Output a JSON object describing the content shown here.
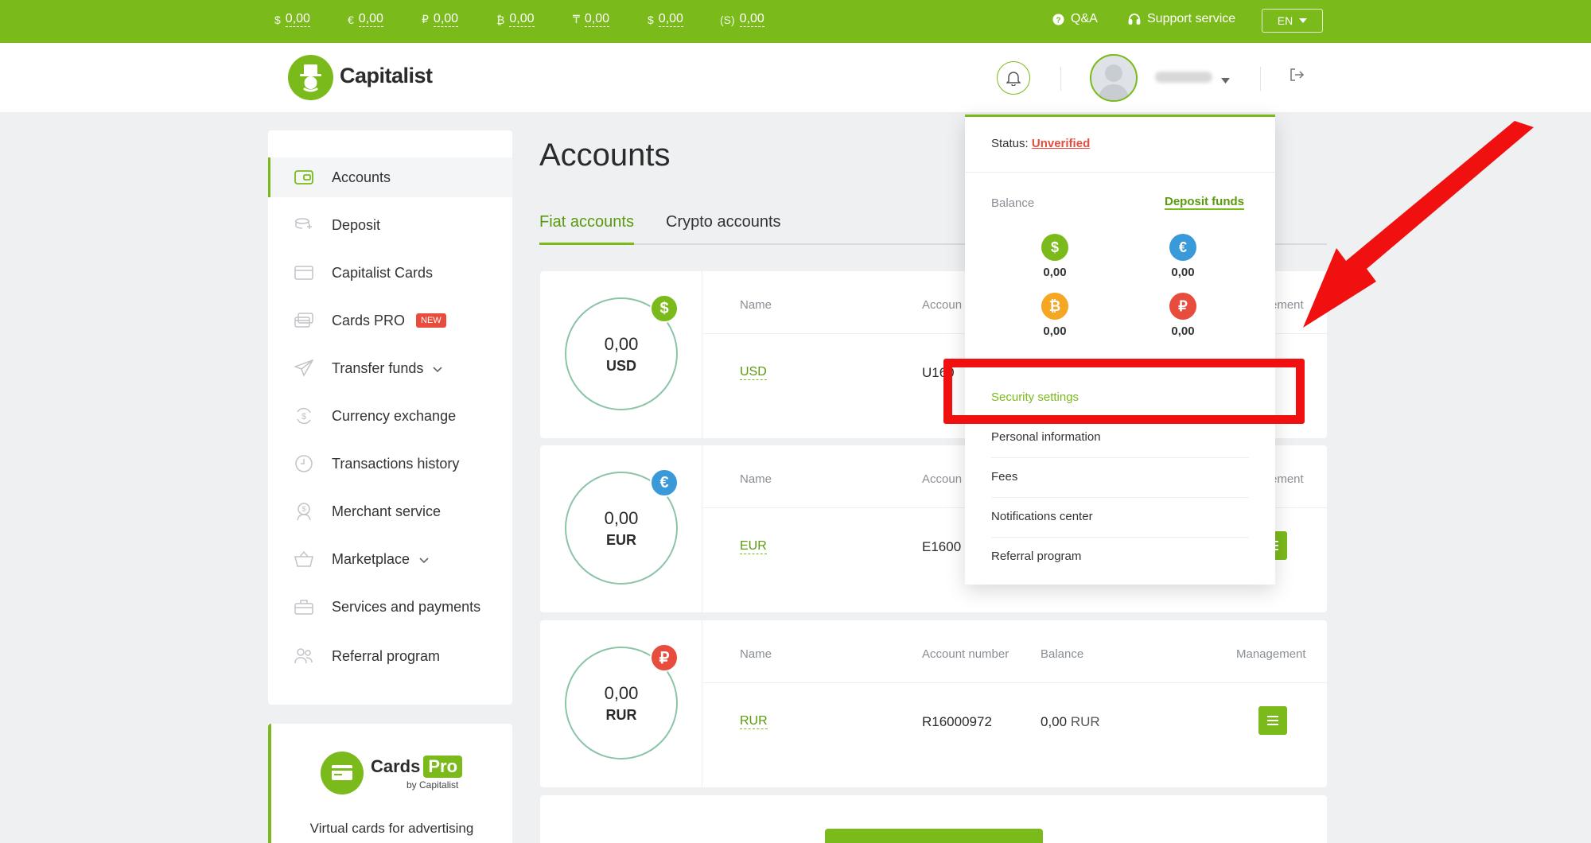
{
  "topbar": {
    "balances": [
      {
        "symbol": "$",
        "amount": "0,00"
      },
      {
        "symbol": "€",
        "amount": "0,00"
      },
      {
        "symbol": "₽",
        "amount": "0,00"
      },
      {
        "symbol": "₿",
        "amount": "0,00"
      },
      {
        "symbol": "₸",
        "amount": "0,00"
      },
      {
        "symbol": "$",
        "amount": "0,00"
      },
      {
        "symbol": "(S)",
        "amount": "0,00"
      }
    ],
    "qa_label": "Q&A",
    "support_label": "Support service",
    "language": "EN",
    "color": "#7aba1a"
  },
  "header": {
    "brand": "Capitalist"
  },
  "sidebar": {
    "items": [
      {
        "label": "Accounts",
        "icon": "wallet-icon"
      },
      {
        "label": "Deposit",
        "icon": "deposit-icon"
      },
      {
        "label": "Capitalist Cards",
        "icon": "card-icon"
      },
      {
        "label": "Cards PRO",
        "icon": "cards-pro-icon",
        "badge": "NEW"
      },
      {
        "label": "Transfer funds",
        "icon": "paper-plane-icon"
      },
      {
        "label": "Currency exchange",
        "icon": "exchange-icon"
      },
      {
        "label": "Transactions history",
        "icon": "clock-icon"
      },
      {
        "label": "Merchant service",
        "icon": "merchant-icon"
      },
      {
        "label": "Marketplace",
        "icon": "basket-icon"
      },
      {
        "label": "Services and payments",
        "icon": "services-icon"
      },
      {
        "label": "Referral program",
        "icon": "people-icon"
      }
    ],
    "active": "Accounts"
  },
  "promo": {
    "title": "Cards",
    "title_badge": "Pro",
    "subtitle": "by Capitalist",
    "description": "Virtual cards for advertising"
  },
  "main": {
    "title": "Accounts",
    "tabs": [
      {
        "label": "Fiat accounts",
        "active": true
      },
      {
        "label": "Crypto accounts",
        "active": false
      }
    ],
    "accounts": [
      {
        "currency": "USD",
        "symbol": "$",
        "value": "0,00",
        "badge_color": "#7aba1a",
        "headers": {
          "name": "Name",
          "account": "Accoun",
          "mgmt": "ement"
        },
        "name": "USD",
        "number": "U160",
        "balance": "",
        "balance_cur": ""
      },
      {
        "currency": "EUR",
        "symbol": "€",
        "value": "0,00",
        "badge_color": "#3a9ad9",
        "headers": {
          "name": "Name",
          "account": "Accoun",
          "mgmt": "ement"
        },
        "name": "EUR",
        "number": "E1600",
        "balance": "",
        "balance_cur": ""
      },
      {
        "currency": "RUR",
        "symbol": "₽",
        "value": "0,00",
        "badge_color": "#e74c3c",
        "headers": {
          "name": "Name",
          "account": "Account number",
          "balance": "Balance",
          "mgmt": "Management"
        },
        "name": "RUR",
        "number": "R16000972",
        "balance": "0,00",
        "balance_cur": "RUR"
      }
    ]
  },
  "dropdown": {
    "status_label": "Status:",
    "status_value": "Unverified",
    "balance_label": "Balance",
    "deposit_link": "Deposit funds",
    "coins": [
      {
        "symbol": "$",
        "value": "0,00",
        "color": "#7aba1a"
      },
      {
        "symbol": "€",
        "value": "0,00",
        "color": "#3a9ad9"
      },
      {
        "symbol": "₿",
        "value": "0,00",
        "color": "#f5a623"
      },
      {
        "symbol": "₽",
        "value": "0,00",
        "color": "#e74c3c"
      }
    ],
    "menu": [
      {
        "label": "Security settings",
        "highlighted": true
      },
      {
        "label": "Personal information"
      },
      {
        "label": "Fees"
      },
      {
        "label": "Notifications center"
      },
      {
        "label": "Referral program"
      }
    ]
  },
  "annotation": {
    "box_color": "#f01010",
    "arrow_color": "#f01010"
  }
}
